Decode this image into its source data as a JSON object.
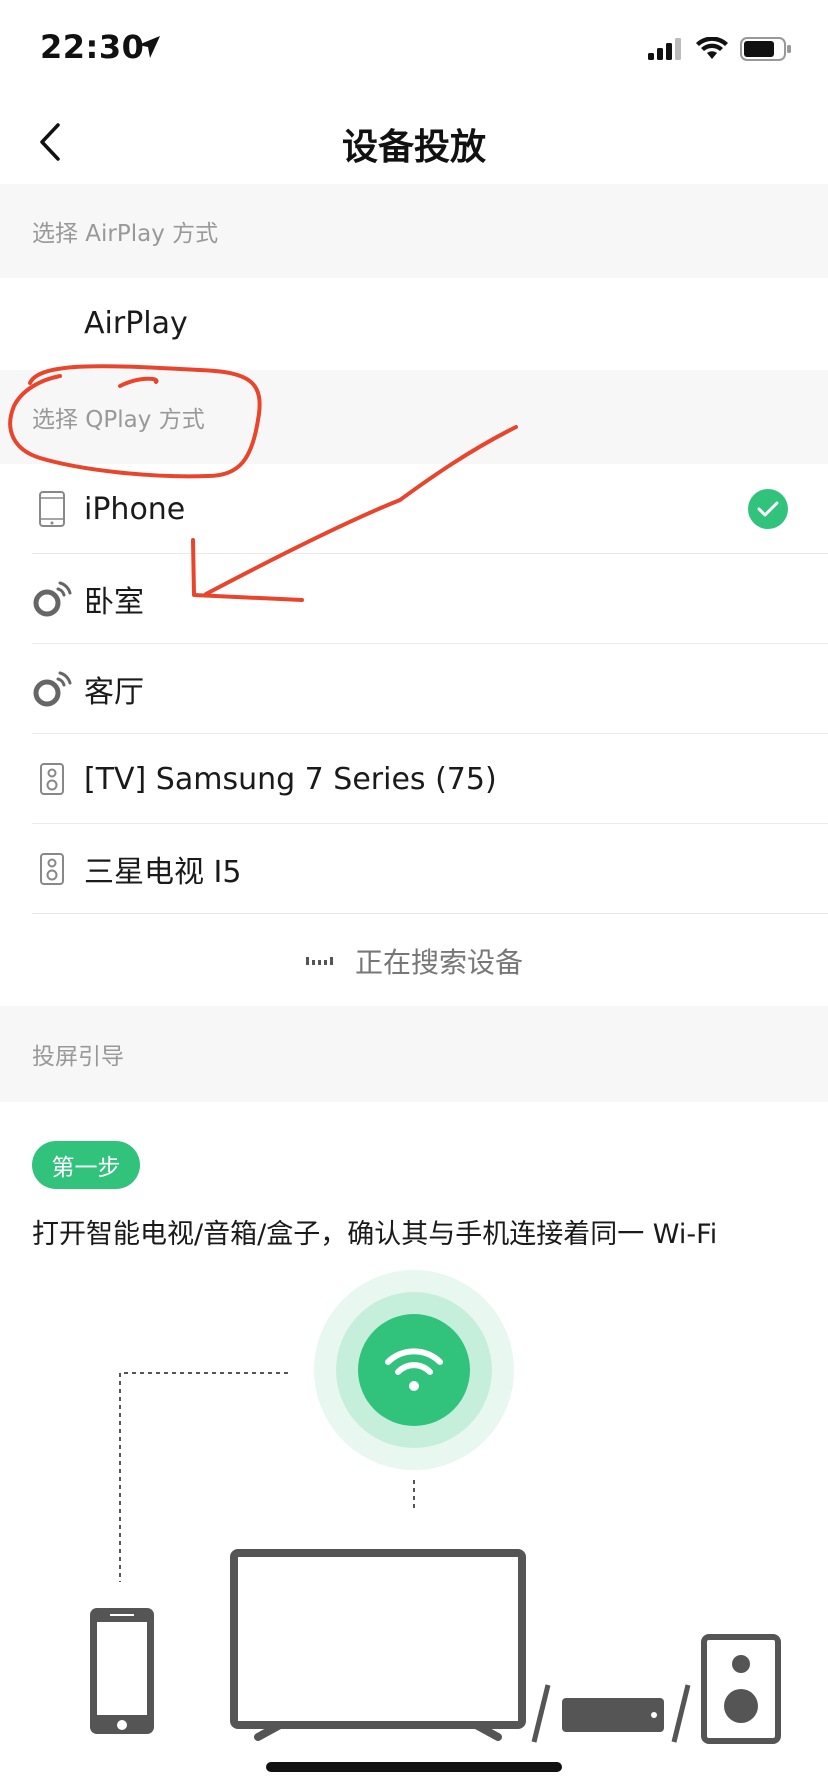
{
  "status_bar": {
    "time": "22:30",
    "icons": [
      "location-arrow-icon",
      "signal-icon",
      "wifi-icon",
      "battery-icon"
    ]
  },
  "nav": {
    "title": "设备投放",
    "back_icon": "chevron-left-icon"
  },
  "airplay_section": {
    "header": "选择 AirPlay 方式",
    "items": [
      {
        "label": "AirPlay"
      }
    ]
  },
  "qplay_section": {
    "header": "选择 QPlay 方式",
    "items": [
      {
        "label": "iPhone",
        "icon": "phone-icon",
        "selected": true
      },
      {
        "label": "卧室",
        "icon": "speaker-ring-icon",
        "selected": false
      },
      {
        "label": "客厅",
        "icon": "speaker-ring-icon",
        "selected": false
      },
      {
        "label": "[TV] Samsung 7 Series (75)",
        "icon": "speaker-box-icon",
        "selected": false
      },
      {
        "label": "三星电视 I5",
        "icon": "speaker-box-icon",
        "selected": false
      }
    ],
    "searching_text": "正在搜索设备"
  },
  "guide_section": {
    "header": "投屏引导",
    "step_badge": "第一步",
    "step_text": "打开智能电视/音箱/盒子，确认其与手机连接着同一 Wi-Fi"
  },
  "colors": {
    "accent": "#31c27c",
    "section_bg": "#f7f7f7",
    "annotation": "#e8452c"
  }
}
